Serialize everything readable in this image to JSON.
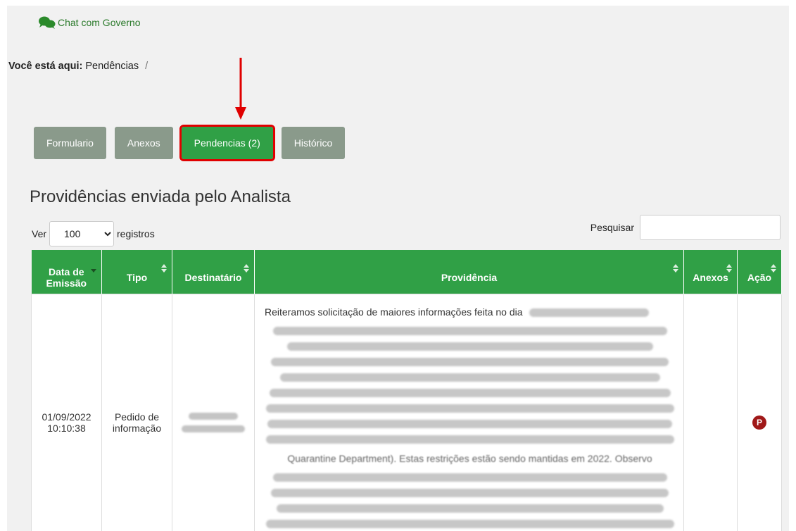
{
  "header": {
    "chat_label": "Chat com Governo"
  },
  "breadcrumb": {
    "prefix": "Você está aqui:",
    "current": "Pendências",
    "separator": "/"
  },
  "tabs": [
    {
      "label": "Formulario",
      "active": false
    },
    {
      "label": "Anexos",
      "active": false
    },
    {
      "label": "Pendencias (2)",
      "active": true
    },
    {
      "label": "Histórico",
      "active": false
    }
  ],
  "section": {
    "title": "Providências enviada pelo Analista"
  },
  "controls": {
    "ver_label": "Ver",
    "page_size": "100",
    "registros_label": "registros",
    "search_label": "Pesquisar",
    "search_value": ""
  },
  "table": {
    "columns": [
      "Data de Emissão",
      "Tipo",
      "Destinatário",
      "Providência",
      "Anexos",
      "Ação"
    ],
    "rows": [
      {
        "data_date": "01/09/2022",
        "data_time": "10:10:38",
        "tipo": "Pedido de informação",
        "providencia_start": "Reiteramos solicitação de maiores informações feita no dia",
        "providencia_fragment": "Quarantine Department). Estas restrições estão sendo mantidas em 2022. Observo",
        "acao": "P"
      }
    ]
  },
  "colors": {
    "accent_green": "#30a046",
    "tab_gray": "#8a9a8b",
    "highlight_red": "#e00000",
    "badge_red": "#a01818"
  }
}
